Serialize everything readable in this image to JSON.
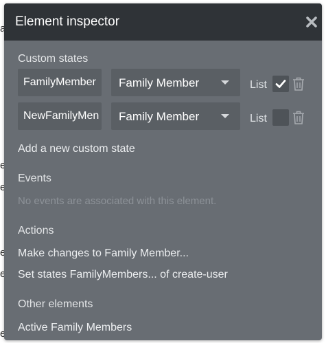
{
  "panel": {
    "title": "Element inspector",
    "close_icon": "close-icon"
  },
  "background": {
    "fragments": [
      "a",
      "e",
      "e",
      "e",
      "e",
      "e"
    ]
  },
  "custom_states": {
    "heading": "Custom states",
    "rows": [
      {
        "name_value": "FamilyMember",
        "type_value": "Family Member",
        "list_label": "List",
        "list_checked": true
      },
      {
        "name_value": "NewFamilyMen",
        "type_value": "Family Member",
        "list_label": "List",
        "list_checked": false
      }
    ],
    "add_label": "Add a new custom state"
  },
  "events": {
    "heading": "Events",
    "empty_text": "No events are associated with this element."
  },
  "actions": {
    "heading": "Actions",
    "items": [
      "Make changes to Family Member...",
      "Set states FamilyMembers... of create-user"
    ]
  },
  "other_elements": {
    "heading": "Other elements",
    "items": [
      "Active Family Members"
    ]
  },
  "colors": {
    "panel_bg": "#686d73",
    "header_bg": "#2f3337",
    "field_bg": "#5a5f64"
  }
}
